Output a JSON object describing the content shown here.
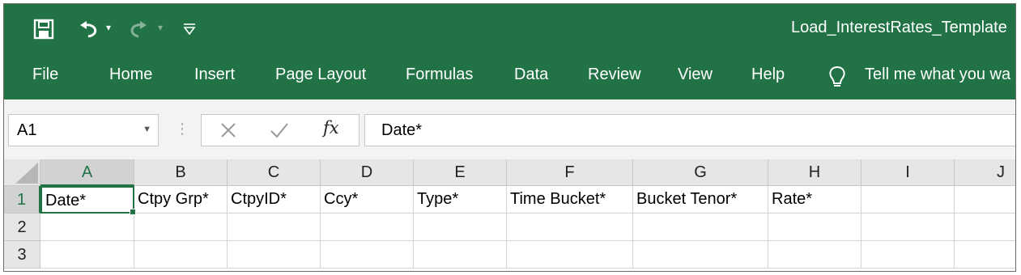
{
  "titlebar": {
    "doc_title": "Load_InterestRates_Template"
  },
  "qat": {
    "save_icon": "save-icon",
    "undo_icon": "undo-icon",
    "redo_icon": "redo-icon",
    "customize_icon": "customize-qat-icon"
  },
  "ribbon": {
    "tabs": [
      {
        "label": "File"
      },
      {
        "label": "Home"
      },
      {
        "label": "Insert"
      },
      {
        "label": "Page Layout"
      },
      {
        "label": "Formulas"
      },
      {
        "label": "Data"
      },
      {
        "label": "Review"
      },
      {
        "label": "View"
      },
      {
        "label": "Help"
      }
    ],
    "tell_me": "Tell me what you wa",
    "tell_me_icon": "lightbulb-icon"
  },
  "formula_bar": {
    "name_box": "A1",
    "fx_label": "fx",
    "value": "Date*"
  },
  "sheet": {
    "columns": [
      "A",
      "B",
      "C",
      "D",
      "E",
      "F",
      "G",
      "H",
      "I",
      "J"
    ],
    "rows": [
      "1",
      "2",
      "3"
    ],
    "cells": [
      [
        "Date*",
        "Ctpy Grp*",
        "CtpyID*",
        "Ccy*",
        "Type*",
        "Time Bucket*",
        "Bucket Tenor*",
        "Rate*",
        "",
        ""
      ],
      [
        "",
        "",
        "",
        "",
        "",
        "",
        "",
        "",
        "",
        ""
      ],
      [
        "",
        "",
        "",
        "",
        "",
        "",
        "",
        "",
        "",
        ""
      ]
    ],
    "active_cell": "A1"
  },
  "colors": {
    "excel_green": "#217346",
    "header_gray": "#e6e6e6",
    "formula_bg": "#f3f3f3"
  }
}
